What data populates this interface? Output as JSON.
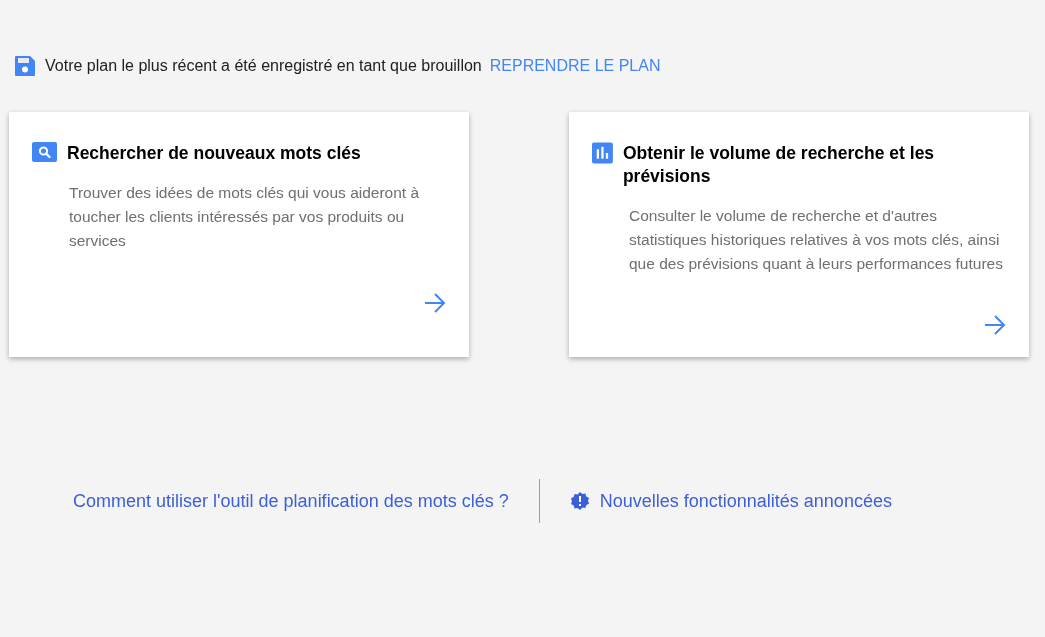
{
  "draft_banner": {
    "message": "Votre plan le plus récent a été enregistré en tant que brouillon",
    "link": "REPRENDRE LE PLAN"
  },
  "cards": [
    {
      "kind": "search",
      "title": "Rechercher de nouveaux mots clés",
      "description": "Trouver des idées de mots clés qui vous aideront à toucher les clients intéressés par vos produits ou services"
    },
    {
      "kind": "volume",
      "title": "Obtenir le volume de recherche et les prévisions",
      "description": "Consulter le volume de recherche et d'autres statistiques historiques relatives à vos mots clés, ainsi que des prévisions quant à leurs performances futures"
    }
  ],
  "footer_links": [
    {
      "kind": "help",
      "label": "Comment utiliser l'outil de planification des mots clés ?"
    },
    {
      "kind": "new",
      "label": "Nouvelles fonctionnalités annoncées"
    }
  ]
}
